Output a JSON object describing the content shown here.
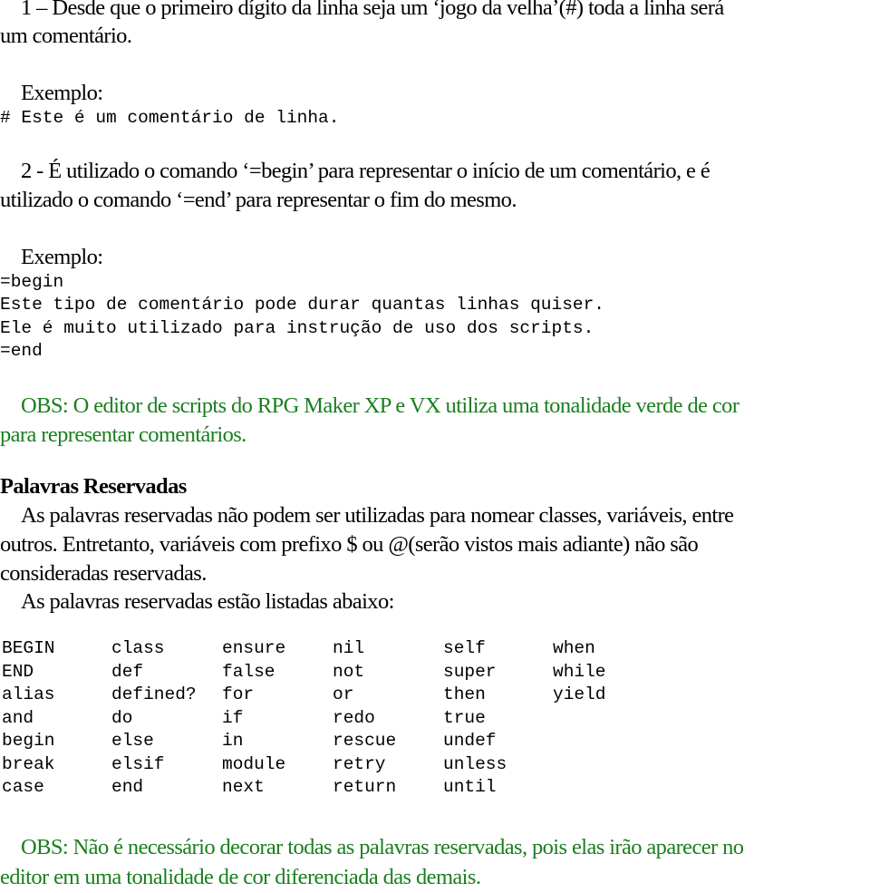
{
  "section1": {
    "line1": "1 – Desde que o primeiro dígito da linha seja um ‘jogo da velha’(#) toda a linha será",
    "line2": "um comentário.",
    "example_label": "Exemplo:",
    "code": "# Este é um comentário de linha."
  },
  "section2": {
    "line1": "2 - É utilizado o comando ‘=begin’ para representar o início de um comentário, e é",
    "line2": "utilizado o comando ‘=end’ para representar o fim do mesmo.",
    "example_label": "Exemplo:",
    "code": [
      "=begin",
      "Este tipo de comentário pode durar quantas linhas quiser.",
      "Ele é muito utilizado para instrução de uso dos scripts.",
      "=end"
    ]
  },
  "obs1": {
    "line1": "OBS: O editor de scripts do RPG Maker XP e VX utiliza uma tonalidade verde de cor",
    "line2": "para representar comentários.",
    "color": "#1a7f1f"
  },
  "reserved": {
    "heading": "Palavras Reservadas",
    "para1": [
      "As palavras reservadas não podem ser utilizadas para nomear classes, variáveis, entre",
      "outros. Entretanto, variáveis com prefixo $ ou @(serão vistos mais adiante) não são",
      "consideradas reservadas."
    ],
    "para2": "As palavras reservadas estão listadas abaixo:",
    "keywords": [
      [
        "BEGIN",
        "class",
        "ensure",
        "nil",
        "self",
        "when"
      ],
      [
        "END",
        "def",
        "false",
        "not",
        "super",
        "while"
      ],
      [
        "alias",
        "defined?",
        "for",
        "or",
        "then",
        "yield"
      ],
      [
        "and",
        "do",
        "if",
        "redo",
        "true",
        ""
      ],
      [
        "begin",
        "else",
        "in",
        "rescue",
        "undef",
        ""
      ],
      [
        "break",
        "elsif",
        "module",
        "retry",
        "unless",
        ""
      ],
      [
        "case",
        "end",
        "next",
        "return",
        "until",
        ""
      ]
    ]
  },
  "obs2": {
    "line1": "OBS: Não é necessário decorar todas as palavras reservadas, pois elas irão aparecer no",
    "line2": "editor em uma tonalidade de cor diferenciada das demais.",
    "color": "#1a7f1f"
  }
}
